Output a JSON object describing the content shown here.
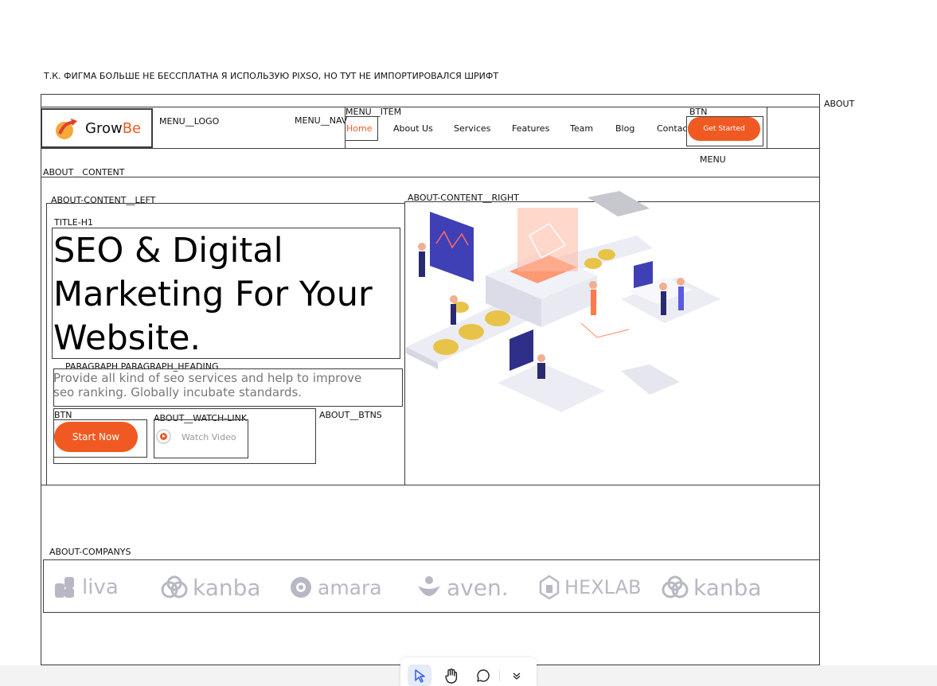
{
  "note": "Т.К. ФИГМА БОЛЬШЕ НЕ БЕССПЛАТНА Я ИСПОЛЬЗУЮ PIXSO, НО ТУТ НЕ ИМПОРТИРОВАЛСЯ ШРИФТ",
  "layer_labels": {
    "about": "ABOUT",
    "menu_logo": "MENU__LOGO",
    "menu_nav": "MENU__NAV",
    "menu_item": "MENU__ITEM",
    "btn_header": "BTN",
    "menu": "MENU",
    "about_content": "ABOUT__CONTENT",
    "about_content_left": "ABOUT-CONTENT__LEFT",
    "about_content_right": "ABOUT-CONTENT__RIGHT",
    "title_h1": "TITLE-H1",
    "paragraph": "PARAGRAPH PARAGRAPH_HEADING",
    "btn_hero": "BTN",
    "watch_link": "ABOUT__WATCH-LINK",
    "about_btns": "ABOUT__BTNS",
    "about_companys": "ABOUT-COMPANYS"
  },
  "logo": {
    "part1": "Grow",
    "part2": "Be"
  },
  "nav": {
    "items": [
      "Home",
      "About Us",
      "Services",
      "Features",
      "Team",
      "Blog",
      "Contact"
    ],
    "cta": "Get Started"
  },
  "hero": {
    "title": "SEO & Digital Marketing For Your Website.",
    "paragraph": "Provide all kind of seo services and help to improve seo ranking. Globally incubate standards.",
    "start_btn": "Start Now",
    "watch_link": "Watch Video"
  },
  "companies": [
    "liva",
    "kanba",
    "amara",
    "aven.",
    "HEXLAB",
    "kanba"
  ],
  "colors": {
    "accent": "#f05a22",
    "logo_gray": "#b8b8c4",
    "frame": "#3c3c3c"
  },
  "toolbar": {
    "tools": [
      "pointer-icon",
      "hand-icon",
      "comment-icon",
      "chevron-down-icon"
    ]
  }
}
